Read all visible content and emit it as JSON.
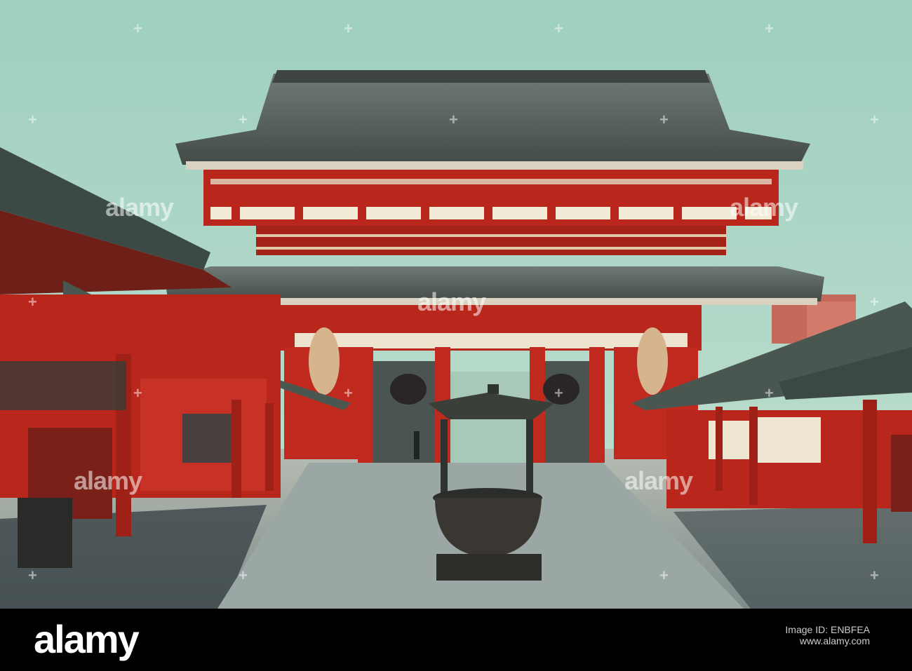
{
  "photo": {
    "subject": "temple gate",
    "colors": {
      "sky": "#a9d6c4",
      "roof": "#5c6560",
      "red": "#b8261c",
      "pavement": "#8f9a96",
      "shadow": "#2d3a3a"
    }
  },
  "watermark": {
    "text": "alamy",
    "plus": "+"
  },
  "footer": {
    "logo": "alamy",
    "caption": "Image ID: ENBFEA",
    "image_id": "ENBFEA",
    "url": "www.alamy.com"
  }
}
